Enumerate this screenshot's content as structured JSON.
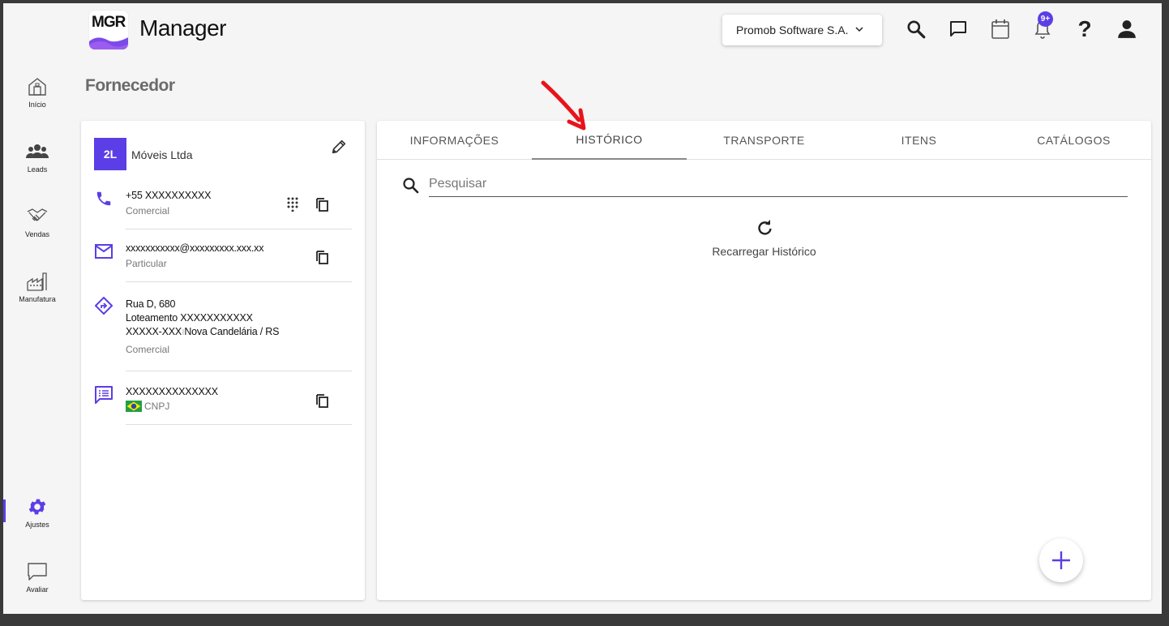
{
  "header": {
    "logo_text": "MGR",
    "app_title": "Manager",
    "company": "Promob Software S.A.",
    "notification_badge": "9+"
  },
  "sidebar": {
    "items": [
      {
        "label": "Início",
        "icon": "home-icon"
      },
      {
        "label": "Leads",
        "icon": "people-icon"
      },
      {
        "label": "Vendas",
        "icon": "handshake-icon"
      },
      {
        "label": "Manufatura",
        "icon": "factory-icon"
      },
      {
        "label": "Ajustes",
        "icon": "gear-icon",
        "active": true
      },
      {
        "label": "Avaliar",
        "icon": "chat-bubble-icon"
      }
    ]
  },
  "page": {
    "title": "Fornecedor"
  },
  "vendor": {
    "avatar_initials": "2L",
    "name": "Móveis Ltda",
    "phone": {
      "value": "+55 XXXXXXXXXX",
      "type": "Comercial"
    },
    "email": {
      "value": "xxxxxxxxxxx@xxxxxxxxx.xxx.xx",
      "type": "Particular"
    },
    "address": {
      "line1": "Rua D, 680",
      "line2": "Loteamento  XXXXXXXXXXX",
      "line3": "XXXXX-XXX",
      "line3b": "Nova Candelária / RS",
      "type": "Comercial"
    },
    "document": {
      "value": "XXXXXXXXXXXXXX",
      "type": "CNPJ"
    }
  },
  "tabs": [
    {
      "label": "INFORMAÇÕES"
    },
    {
      "label": "HISTÓRICO",
      "active": true
    },
    {
      "label": "TRANSPORTE"
    },
    {
      "label": "ITENS"
    },
    {
      "label": "CATÁLOGOS"
    }
  ],
  "history": {
    "search_placeholder": "Pesquisar",
    "reload_label": "Recarregar Histórico"
  },
  "colors": {
    "accent": "#5b3ee6",
    "annotation_arrow": "#e8141b"
  }
}
